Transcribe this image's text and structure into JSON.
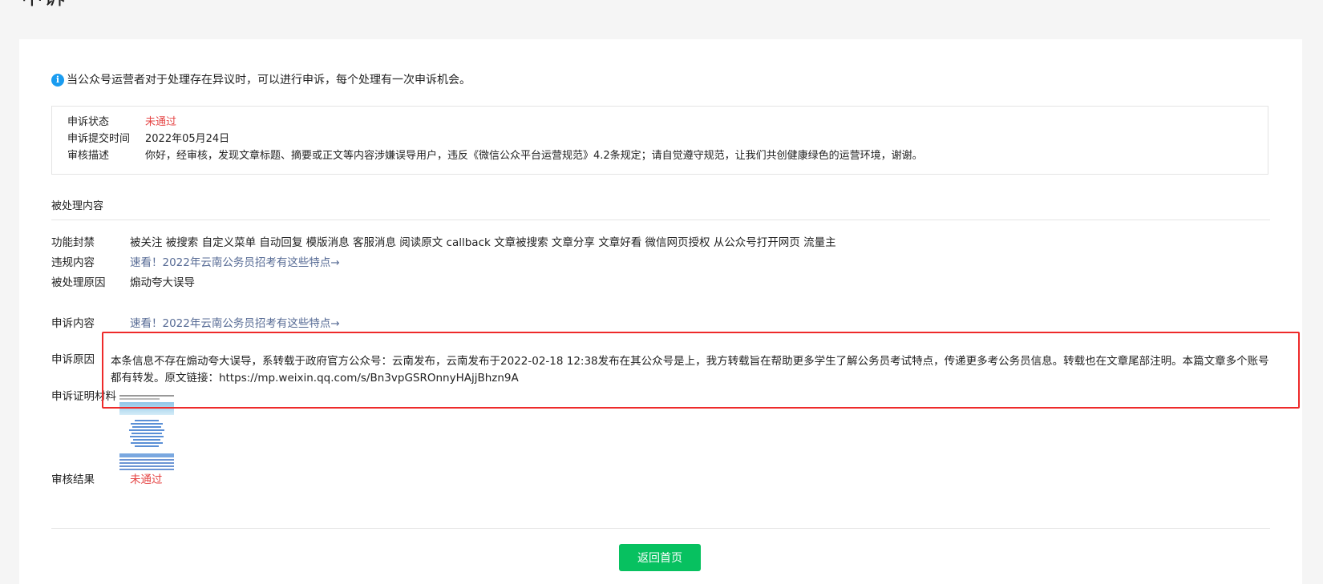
{
  "page": {
    "title": "申诉"
  },
  "notice": "当公众号运营者对于处理存在异议时，可以进行申诉，每个处理有一次申诉机会。",
  "status_box": {
    "status_label": "申诉状态",
    "status_value": "未通过",
    "time_label": "申诉提交时间",
    "time_value": "2022年05月24日",
    "desc_label": "审核描述",
    "desc_value": "你好，经审核，发现文章标题、摘要或正文等内容涉嫌误导用户，违反《微信公众平台运营规范》4.2条规定；请自觉遵守规范，让我们共创健康绿色的运营环境，谢谢。"
  },
  "processed": {
    "section_title": "被处理内容",
    "features_label": "功能封禁",
    "features_value": "被关注 被搜索 自定义菜单 自动回复 模版消息 客服消息 阅读原文 callback 文章被搜索 文章分享 文章好看 微信网页授权 从公众号打开网页 流量主",
    "violation_label": "违规内容",
    "violation_link": "速看！2022年云南公务员招考有这些特点→",
    "reason_label": "被处理原因",
    "reason_value": "煽动夸大误导"
  },
  "appeal": {
    "content_label": "申诉内容",
    "content_link": "速看！2022年云南公务员招考有这些特点→",
    "reason_label": "申诉原因",
    "reason_value": "本条信息不存在煽动夸大误导，系转载于政府官方公众号：云南发布，云南发布于2022-02-18 12:38发布在其公众号是上，我方转载旨在帮助更多学生了解公务员考试特点，传递更多考公务员信息。转载也在文章尾部注明。本篇文章多个账号都有转发。原文链接：https://mp.weixin.qq.com/s/Bn3vpGSROnnyHAjjBhzn9A",
    "evidence_label": "申诉证明材料",
    "result_label": "审核结果",
    "result_value": "未通过"
  },
  "buttons": {
    "back_home": "返回首页"
  },
  "colors": {
    "accent": "#07c160",
    "status_red": "#e54545",
    "link": "#576b95",
    "highlight": "#ee2a2a"
  }
}
